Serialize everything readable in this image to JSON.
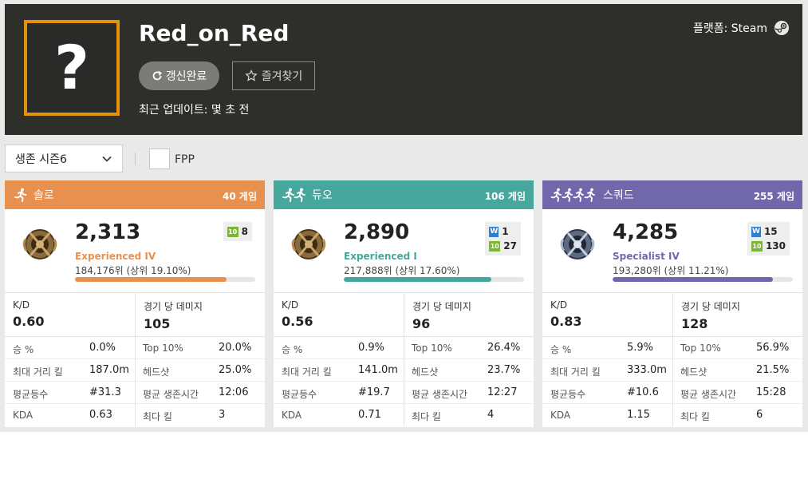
{
  "header": {
    "player_name": "Red_on_Red",
    "avatar_glyph": "?",
    "refresh_label": "갱신완료",
    "favorite_label": "즐겨찾기",
    "last_update": "최근 업데이트: 몇 초 전",
    "platform": "플랫폼: Steam"
  },
  "filters": {
    "season": "생존 시즌6",
    "fpp_label": "FPP",
    "fpp_checked": false
  },
  "cards": [
    {
      "mode": "솔로",
      "games": "40 게임",
      "color": "#e8914f",
      "rating": "2,313",
      "tier": "Experienced IV",
      "rank": "184,176위 (상위 19.10%)",
      "progress": 0.84,
      "medals": [
        {
          "type": "10",
          "count": "8"
        }
      ],
      "kd_label": "K/D",
      "kd": "0.60",
      "dmg_label": "경기 당 데미지",
      "dmg": "105",
      "rows": [
        {
          "k1": "승 %",
          "v1": "0.0%",
          "k2": "Top 10%",
          "v2": "20.0%"
        },
        {
          "k1": "최대 거리 킬",
          "v1": "187.0m",
          "k2": "헤드샷",
          "v2": "25.0%"
        },
        {
          "k1": "평균등수",
          "v1": "#31.3",
          "k2": "평균 생존시간",
          "v2": "12:06"
        },
        {
          "k1": "KDA",
          "v1": "0.63",
          "k2": "최다 킬",
          "v2": "3"
        }
      ]
    },
    {
      "mode": "듀오",
      "games": "106 게임",
      "color": "#46a79c",
      "rating": "2,890",
      "tier": "Experienced I",
      "rank": "217,888위 (상위 17.60%)",
      "progress": 0.82,
      "medals": [
        {
          "type": "W",
          "count": "1"
        },
        {
          "type": "10",
          "count": "27"
        }
      ],
      "kd_label": "K/D",
      "kd": "0.56",
      "dmg_label": "경기 당 데미지",
      "dmg": "96",
      "rows": [
        {
          "k1": "승 %",
          "v1": "0.9%",
          "k2": "Top 10%",
          "v2": "26.4%"
        },
        {
          "k1": "최대 거리 킬",
          "v1": "141.0m",
          "k2": "헤드샷",
          "v2": "23.7%"
        },
        {
          "k1": "평균등수",
          "v1": "#19.7",
          "k2": "평균 생존시간",
          "v2": "12:27"
        },
        {
          "k1": "KDA",
          "v1": "0.71",
          "k2": "최다 킬",
          "v2": "4"
        }
      ]
    },
    {
      "mode": "스쿼드",
      "games": "255 게임",
      "color": "#7167ab",
      "rating": "4,285",
      "tier": "Specialist IV",
      "rank": "193,280위 (상위 11.21%)",
      "progress": 0.89,
      "medals": [
        {
          "type": "W",
          "count": "15"
        },
        {
          "type": "10",
          "count": "130"
        }
      ],
      "kd_label": "K/D",
      "kd": "0.83",
      "dmg_label": "경기 당 데미지",
      "dmg": "128",
      "rows": [
        {
          "k1": "승 %",
          "v1": "5.9%",
          "k2": "Top 10%",
          "v2": "56.9%"
        },
        {
          "k1": "최대 거리 킬",
          "v1": "333.0m",
          "k2": "헤드샷",
          "v2": "21.5%"
        },
        {
          "k1": "평균등수",
          "v1": "#10.6",
          "k2": "평균 생존시간",
          "v2": "15:28"
        },
        {
          "k1": "KDA",
          "v1": "1.15",
          "k2": "최다 킬",
          "v2": "6"
        }
      ]
    }
  ]
}
